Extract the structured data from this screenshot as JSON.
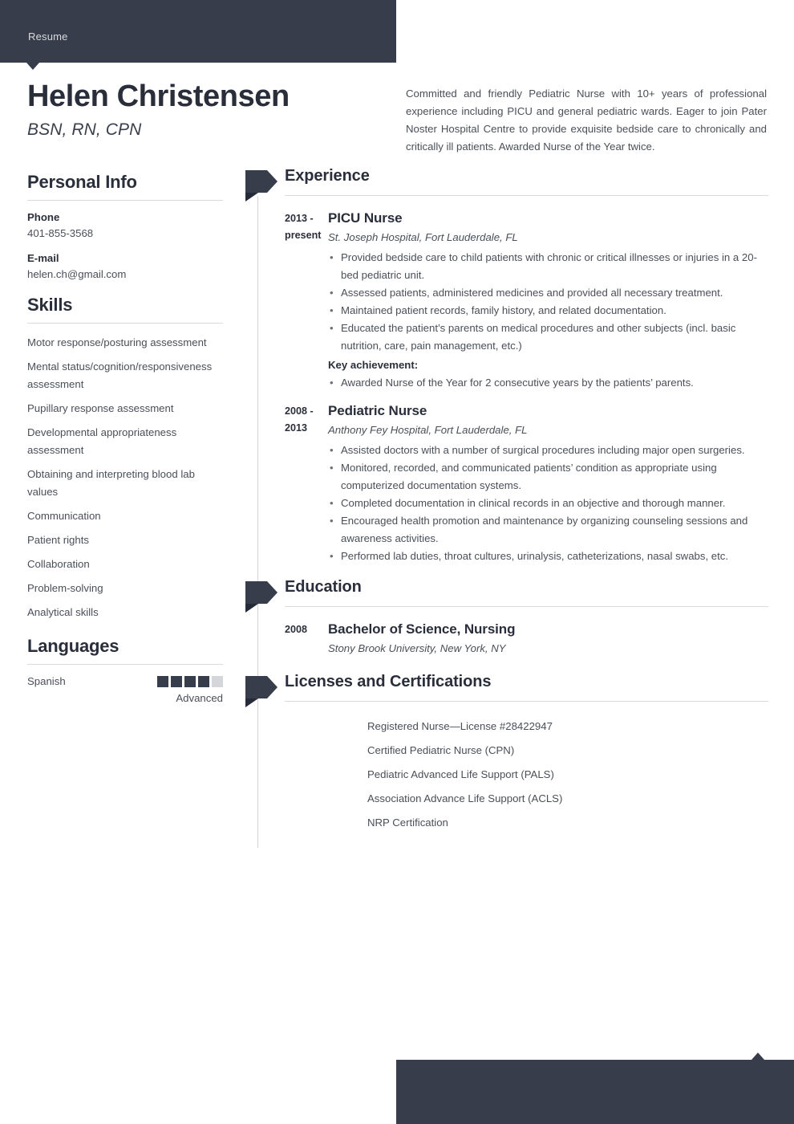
{
  "document": {
    "header_label": "Resume",
    "accent_dark": "#373D4A",
    "accent_fold": "#252B38",
    "rule_color": "#D9DADD",
    "text_color": "#4A4F58"
  },
  "profile": {
    "name": "Helen Christensen",
    "credentials": "BSN, RN, CPN",
    "summary": "Committed and friendly Pediatric Nurse with 10+ years of professional experience including PICU and general pediatric wards. Eager to join Pater Noster Hospital Centre to provide exquisite bedside care to chronically and critically ill patients. Awarded Nurse of the Year twice."
  },
  "sidebar": {
    "personal_info": {
      "heading": "Personal Info",
      "fields": [
        {
          "label": "Phone",
          "value": "401-855-3568"
        },
        {
          "label": "E-mail",
          "value": "helen.ch@gmail.com"
        }
      ]
    },
    "skills": {
      "heading": "Skills",
      "items": [
        "Motor response/posturing assessment",
        "Mental status/cognition/responsiveness assessment",
        "Pupillary response assessment",
        "Developmental appropriateness assessment",
        "Obtaining and interpreting blood lab values",
        "Communication",
        "Patient rights",
        "Collaboration",
        "Problem-solving",
        "Analytical skills"
      ]
    },
    "languages": {
      "heading": "Languages",
      "items": [
        {
          "name": "Spanish",
          "level_label": "Advanced",
          "filled": 4,
          "total": 5
        }
      ]
    }
  },
  "main": {
    "experience": {
      "heading": "Experience",
      "entries": [
        {
          "date": "2013 - present",
          "role": "PICU Nurse",
          "org": "St. Joseph Hospital, Fort Lauderdale, FL",
          "bullets": [
            "Provided bedside care to child patients with chronic or critical illnesses or injuries in a 20-bed pediatric unit.",
            "Assessed patients, administered medicines and provided all necessary treatment.",
            "Maintained patient records, family history, and related documentation.",
            "Educated the patient’s parents on medical procedures and other subjects (incl. basic nutrition, care, pain management, etc.)"
          ],
          "key_achievement_label": "Key achievement:",
          "key_achievements": [
            "Awarded Nurse of the Year for 2 consecutive years by the patients’ parents."
          ]
        },
        {
          "date": "2008 - 2013",
          "role": "Pediatric Nurse",
          "org": "Anthony Fey Hospital, Fort Lauderdale, FL",
          "bullets": [
            "Assisted doctors with a number of surgical procedures including major open surgeries.",
            "Monitored, recorded, and communicated patients’ condition as appropriate using computerized documentation systems.",
            "Completed documentation in clinical records in an objective and thorough manner.",
            "Encouraged health promotion and maintenance by organizing counseling sessions and awareness activities.",
            "Performed lab duties, throat cultures, urinalysis, catheterizations, nasal swabs, etc."
          ],
          "key_achievement_label": "",
          "key_achievements": []
        }
      ]
    },
    "education": {
      "heading": "Education",
      "entries": [
        {
          "date": "2008",
          "degree": "Bachelor of Science, Nursing",
          "school": "Stony Brook University, New York, NY"
        }
      ]
    },
    "licenses": {
      "heading": "Licenses and Certifications",
      "items": [
        "Registered Nurse—License #28422947",
        "Certified Pediatric Nurse (CPN)",
        "Pediatric Advanced Life Support (PALS)",
        "Association Advance Life Support (ACLS)",
        "NRP Certification"
      ]
    }
  }
}
